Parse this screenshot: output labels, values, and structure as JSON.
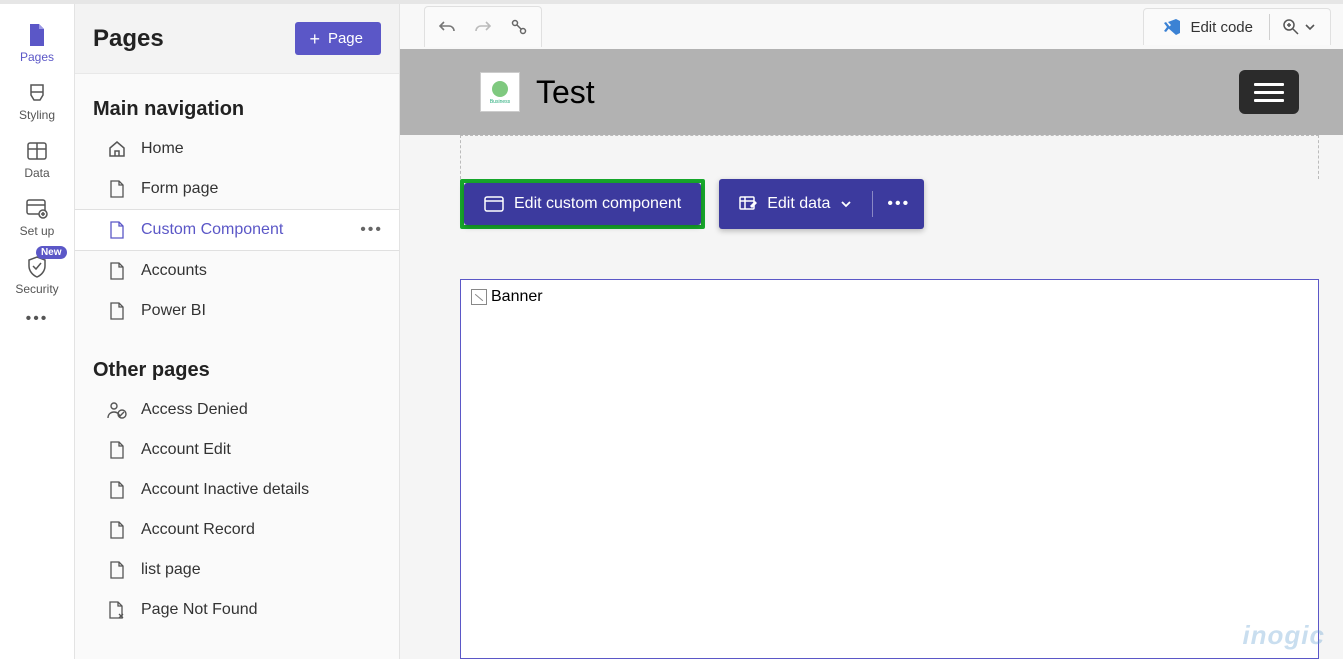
{
  "rail": {
    "items": [
      {
        "label": "Pages"
      },
      {
        "label": "Styling"
      },
      {
        "label": "Data"
      },
      {
        "label": "Set up"
      },
      {
        "label": "Security",
        "badge": "New"
      }
    ]
  },
  "panel": {
    "title": "Pages",
    "new_button": "Page",
    "section_main": "Main navigation",
    "main_items": [
      {
        "label": "Home",
        "icon": "home"
      },
      {
        "label": "Form page",
        "icon": "page"
      },
      {
        "label": "Custom Component",
        "icon": "page",
        "selected": true
      },
      {
        "label": "Accounts",
        "icon": "page"
      },
      {
        "label": "Power BI",
        "icon": "page"
      }
    ],
    "section_other": "Other pages",
    "other_items": [
      {
        "label": "Access Denied",
        "icon": "user-deny"
      },
      {
        "label": "Account Edit",
        "icon": "page"
      },
      {
        "label": "Account Inactive details",
        "icon": "page"
      },
      {
        "label": "Account Record",
        "icon": "page"
      },
      {
        "label": "list page",
        "icon": "page"
      },
      {
        "label": "Page Not Found",
        "icon": "page-x"
      }
    ]
  },
  "cmdbar": {
    "edit_code": "Edit code"
  },
  "preview": {
    "site_title": "Test",
    "toolbar": {
      "edit_component": "Edit custom component",
      "edit_data": "Edit data"
    },
    "banner_alt": "Banner"
  },
  "watermark": "inogic"
}
